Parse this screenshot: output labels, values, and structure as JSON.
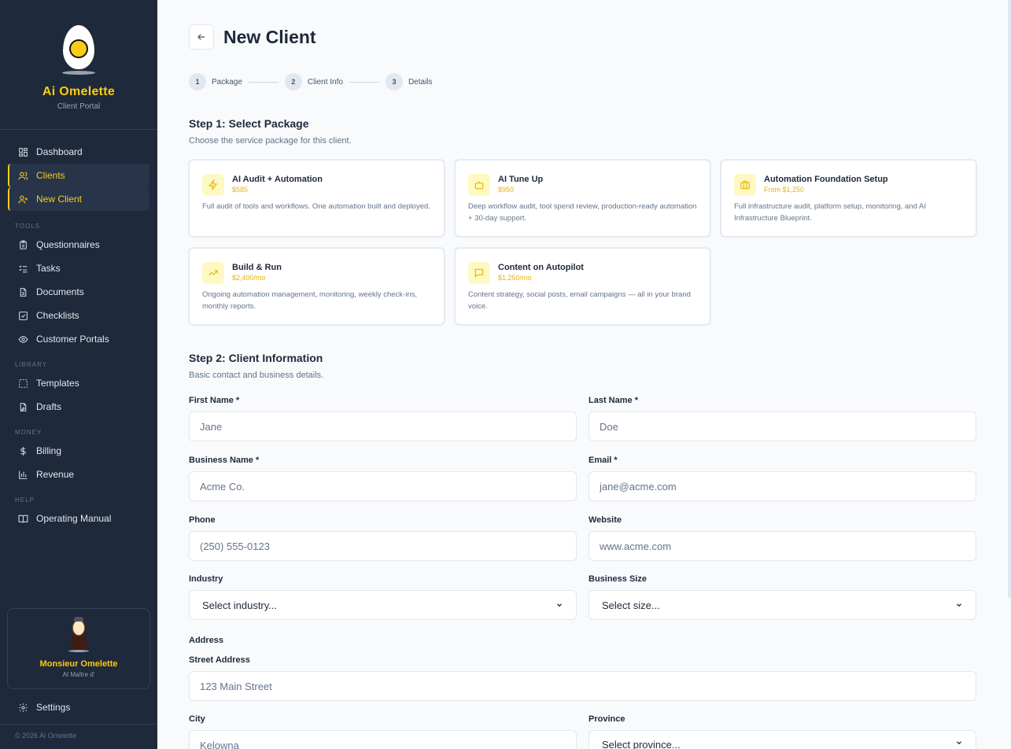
{
  "brand": {
    "name": "Ai Omelette",
    "subtitle": "Client Portal"
  },
  "nav": {
    "dashboard": "Dashboard",
    "clients": "Clients",
    "new_client": "New Client",
    "tools_heading": "TOOLS",
    "questionnaires": "Questionnaires",
    "tasks": "Tasks",
    "documents": "Documents",
    "checklists": "Checklists",
    "customer_portals": "Customer Portals",
    "library_heading": "LIBRARY",
    "templates": "Templates",
    "drafts": "Drafts",
    "money_heading": "MONEY",
    "billing": "Billing",
    "revenue": "Revenue",
    "help_heading": "HELP",
    "operating_manual": "Operating Manual",
    "settings": "Settings"
  },
  "profile": {
    "name": "Monsieur Omelette",
    "role": "AI Maître d'"
  },
  "footer": {
    "copyright": "© 2026 Ai Omelette"
  },
  "page": {
    "title": "New Client"
  },
  "stepper": [
    {
      "num": "1",
      "label": "Package"
    },
    {
      "num": "2",
      "label": "Client Info"
    },
    {
      "num": "3",
      "label": "Details"
    }
  ],
  "step1": {
    "title": "Step 1: Select Package",
    "subtitle": "Choose the service package for this client."
  },
  "packages": [
    {
      "name": "AI Audit + Automation",
      "price": "$585",
      "desc": "Full audit of tools and workflows. One automation built and deployed.",
      "icon": "lightning-icon"
    },
    {
      "name": "AI Tune Up",
      "price": "$950",
      "desc": "Deep workflow audit, tool spend review, production-ready automation + 30-day support.",
      "icon": "bot-icon"
    },
    {
      "name": "Automation Foundation Setup",
      "price": "From $1,250",
      "desc": "Full infrastructure audit, platform setup, monitoring, and AI Infrastructure Blueprint.",
      "icon": "briefcase-icon"
    },
    {
      "name": "Build & Run",
      "price": "$2,400/mo",
      "desc": "Ongoing automation management, monitoring, weekly check-ins, monthly reports.",
      "icon": "trending-up-icon"
    },
    {
      "name": "Content on Autopilot",
      "price": "$1,250/mo",
      "desc": "Content strategy, social posts, email campaigns — all in your brand voice.",
      "icon": "message-icon"
    }
  ],
  "step2": {
    "title": "Step 2: Client Information",
    "subtitle": "Basic contact and business details."
  },
  "form": {
    "first_name_label": "First Name *",
    "first_name_placeholder": "Jane",
    "last_name_label": "Last Name *",
    "last_name_placeholder": "Doe",
    "business_name_label": "Business Name *",
    "business_name_placeholder": "Acme Co.",
    "email_label": "Email *",
    "email_placeholder": "jane@acme.com",
    "phone_label": "Phone",
    "phone_placeholder": "(250) 555-0123",
    "website_label": "Website",
    "website_placeholder": "www.acme.com",
    "industry_label": "Industry",
    "industry_value": "Select industry...",
    "size_label": "Business Size",
    "size_value": "Select size...",
    "address_heading": "Address",
    "street_label": "Street Address",
    "street_placeholder": "123 Main Street",
    "city_label": "City",
    "city_placeholder": "Kelowna",
    "province_label": "Province",
    "province_value": "Select province..."
  },
  "colors": {
    "sidebar": "#1e293b",
    "accent": "#facc15",
    "background": "#f8fafc"
  }
}
